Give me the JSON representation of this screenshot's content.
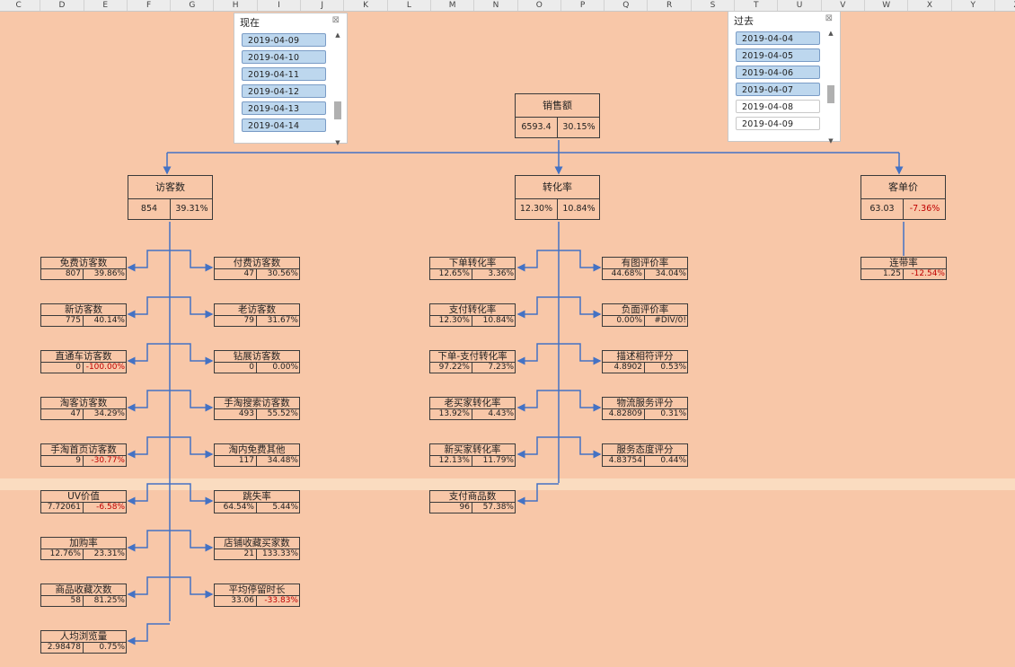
{
  "columns": [
    "C",
    "D",
    "E",
    "F",
    "G",
    "H",
    "I",
    "J",
    "K",
    "L",
    "M",
    "N",
    "O",
    "P",
    "Q",
    "R",
    "S",
    "T",
    "U",
    "V",
    "W",
    "X",
    "Y",
    "Z"
  ],
  "slicers": {
    "now": {
      "title": "现在",
      "items": [
        "2019-04-09",
        "2019-04-10",
        "2019-04-11",
        "2019-04-12",
        "2019-04-13",
        "2019-04-14"
      ]
    },
    "past": {
      "title": "过去",
      "items": [
        "2019-04-04",
        "2019-04-05",
        "2019-04-06",
        "2019-04-07",
        "2019-04-08",
        "2019-04-09"
      ]
    }
  },
  "top": {
    "title": "销售额",
    "value": "6593.4",
    "change": "30.15%"
  },
  "level1": {
    "visitors": {
      "title": "访客数",
      "value": "854",
      "change": "39.31%"
    },
    "conversion": {
      "title": "转化率",
      "value": "12.30%",
      "change": "10.84%"
    },
    "aov": {
      "title": "客单价",
      "value": "63.03",
      "change": "-7.36%"
    }
  },
  "visitor_left": [
    {
      "title": "免费访客数",
      "value": "807",
      "change": "39.86%"
    },
    {
      "title": "新访客数",
      "value": "775",
      "change": "40.14%"
    },
    {
      "title": "直通车访客数",
      "value": "0",
      "change": "-100.00%"
    },
    {
      "title": "淘客访客数",
      "value": "47",
      "change": "34.29%"
    },
    {
      "title": "手淘首页访客数",
      "value": "9",
      "change": "-30.77%"
    },
    {
      "title": "UV价值",
      "value": "7.72061",
      "change": "-6.58%"
    },
    {
      "title": "加购率",
      "value": "12.76%",
      "change": "23.31%"
    },
    {
      "title": "商品收藏次数",
      "value": "58",
      "change": "81.25%"
    },
    {
      "title": "人均浏览量",
      "value": "2.98478",
      "change": "0.75%"
    }
  ],
  "visitor_right": [
    {
      "title": "付费访客数",
      "value": "47",
      "change": "30.56%"
    },
    {
      "title": "老访客数",
      "value": "79",
      "change": "31.67%"
    },
    {
      "title": "钻展访客数",
      "value": "0",
      "change": "0.00%"
    },
    {
      "title": "手淘搜索访客数",
      "value": "493",
      "change": "55.52%"
    },
    {
      "title": "淘内免费其他",
      "value": "117",
      "change": "34.48%"
    },
    {
      "title": "跳失率",
      "value": "64.54%",
      "change": "5.44%"
    },
    {
      "title": "店铺收藏买家数",
      "value": "21",
      "change": "133.33%"
    },
    {
      "title": "平均停留时长",
      "value": "33.06",
      "change": "-33.83%"
    }
  ],
  "conv_left": [
    {
      "title": "下单转化率",
      "value": "12.65%",
      "change": "3.36%"
    },
    {
      "title": "支付转化率",
      "value": "12.30%",
      "change": "10.84%"
    },
    {
      "title": "下单-支付转化率",
      "value": "97.22%",
      "change": "7.23%"
    },
    {
      "title": "老买家转化率",
      "value": "13.92%",
      "change": "4.43%"
    },
    {
      "title": "新买家转化率",
      "value": "12.13%",
      "change": "11.79%"
    },
    {
      "title": "支付商品数",
      "value": "96",
      "change": "57.38%"
    }
  ],
  "conv_right": [
    {
      "title": "有图评价率",
      "value": "44.68%",
      "change": "34.04%"
    },
    {
      "title": "负面评价率",
      "value": "0.00%",
      "change": "#DIV/0!"
    },
    {
      "title": "描述相符评分",
      "value": "4.8902",
      "change": "0.53%"
    },
    {
      "title": "物流服务评分",
      "value": "4.82809",
      "change": "0.31%"
    },
    {
      "title": "服务态度评分",
      "value": "4.83754",
      "change": "0.44%"
    }
  ],
  "aov_children": [
    {
      "title": "连带率",
      "value": "1.25",
      "change": "-12.54%"
    }
  ],
  "colors": {
    "background": "#f8c7a8",
    "connector": "#4472c4",
    "negative": "#c00000",
    "slicer_selected": "#bdd7ee"
  }
}
